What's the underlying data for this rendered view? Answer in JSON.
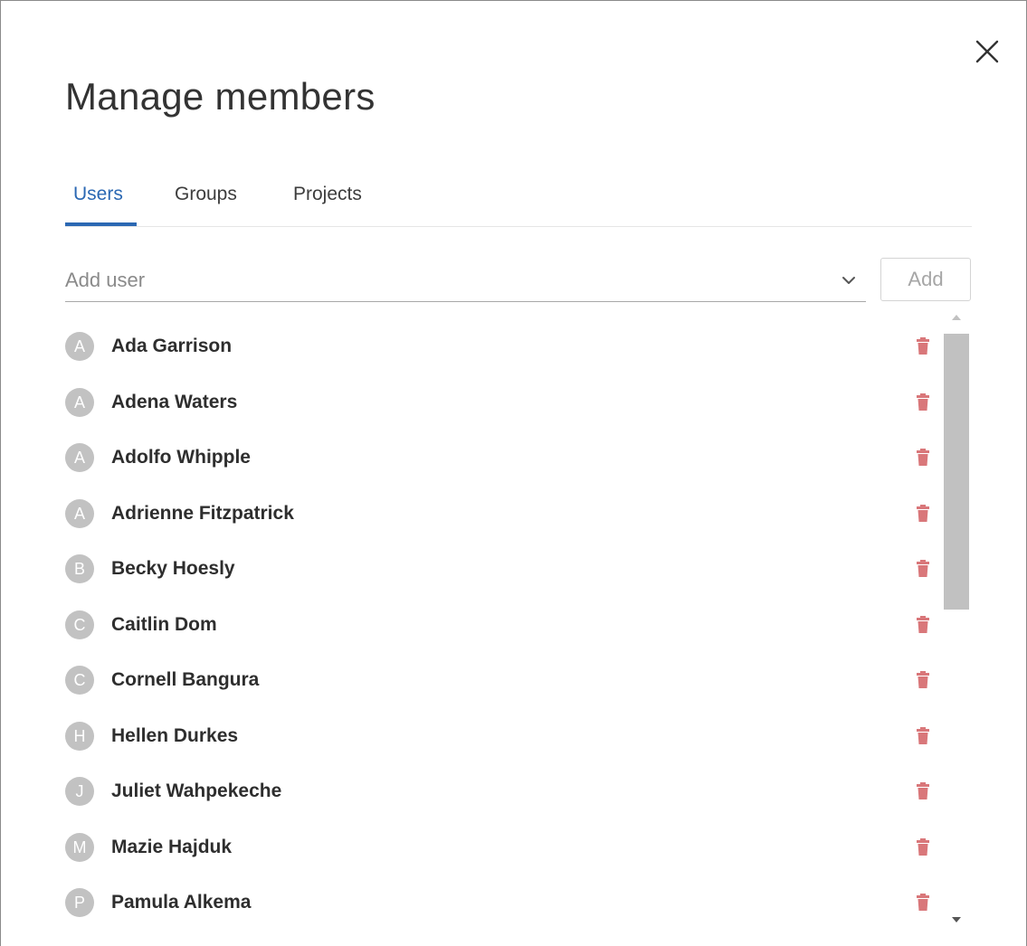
{
  "dialog": {
    "title": "Manage members",
    "close_icon": "close-icon"
  },
  "tabs": [
    {
      "label": "Users",
      "active": true
    },
    {
      "label": "Groups",
      "active": false
    },
    {
      "label": "Projects",
      "active": false
    }
  ],
  "add_user": {
    "placeholder": "Add user",
    "value": "",
    "dropdown_icon": "chevron-down-icon",
    "button_label": "Add",
    "button_enabled": false
  },
  "members": [
    {
      "initial": "A",
      "name": "Ada Garrison"
    },
    {
      "initial": "A",
      "name": "Adena Waters"
    },
    {
      "initial": "A",
      "name": "Adolfo Whipple"
    },
    {
      "initial": "A",
      "name": "Adrienne Fitzpatrick"
    },
    {
      "initial": "B",
      "name": "Becky Hoesly"
    },
    {
      "initial": "C",
      "name": "Caitlin Dom"
    },
    {
      "initial": "C",
      "name": "Cornell Bangura"
    },
    {
      "initial": "H",
      "name": "Hellen Durkes"
    },
    {
      "initial": "J",
      "name": "Juliet Wahpekeche"
    },
    {
      "initial": "M",
      "name": "Mazie Hajduk"
    },
    {
      "initial": "P",
      "name": "Pamula Alkema"
    }
  ],
  "colors": {
    "accent": "#2b68b3",
    "delete": "#d9777a",
    "avatar": "#c2c2c2",
    "scrollbar_thumb": "#c1c1c1"
  },
  "icons": {
    "delete": "trash-icon",
    "scroll_up": "scroll-up-arrow-icon",
    "scroll_down": "scroll-down-arrow-icon"
  }
}
